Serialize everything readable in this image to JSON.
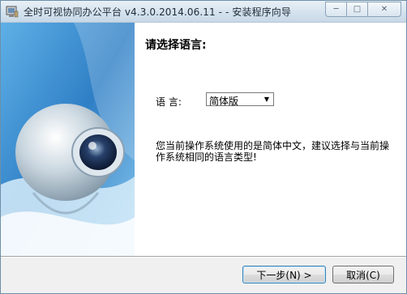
{
  "window": {
    "title": "全时可视协同办公平台 v4.3.0.2014.06.11  -  -  安装程序向导",
    "icons": [
      "installer-app-icon",
      "minimize-icon",
      "maximize-icon",
      "close-icon"
    ]
  },
  "page": {
    "heading": "请选择语言:",
    "language_label": "语    言:",
    "language_selected": "简体版",
    "notice": "您当前操作系统使用的是简体中文，建议选择与当前操作系统相同的语言类型!"
  },
  "buttons": {
    "next": "下一步(N) >",
    "cancel": "取消(C)"
  },
  "colors": {
    "sidebar_blue": "#3f8fd0",
    "sidebar_light": "#bfe0f5",
    "titlebar": "#d8e5f0"
  }
}
